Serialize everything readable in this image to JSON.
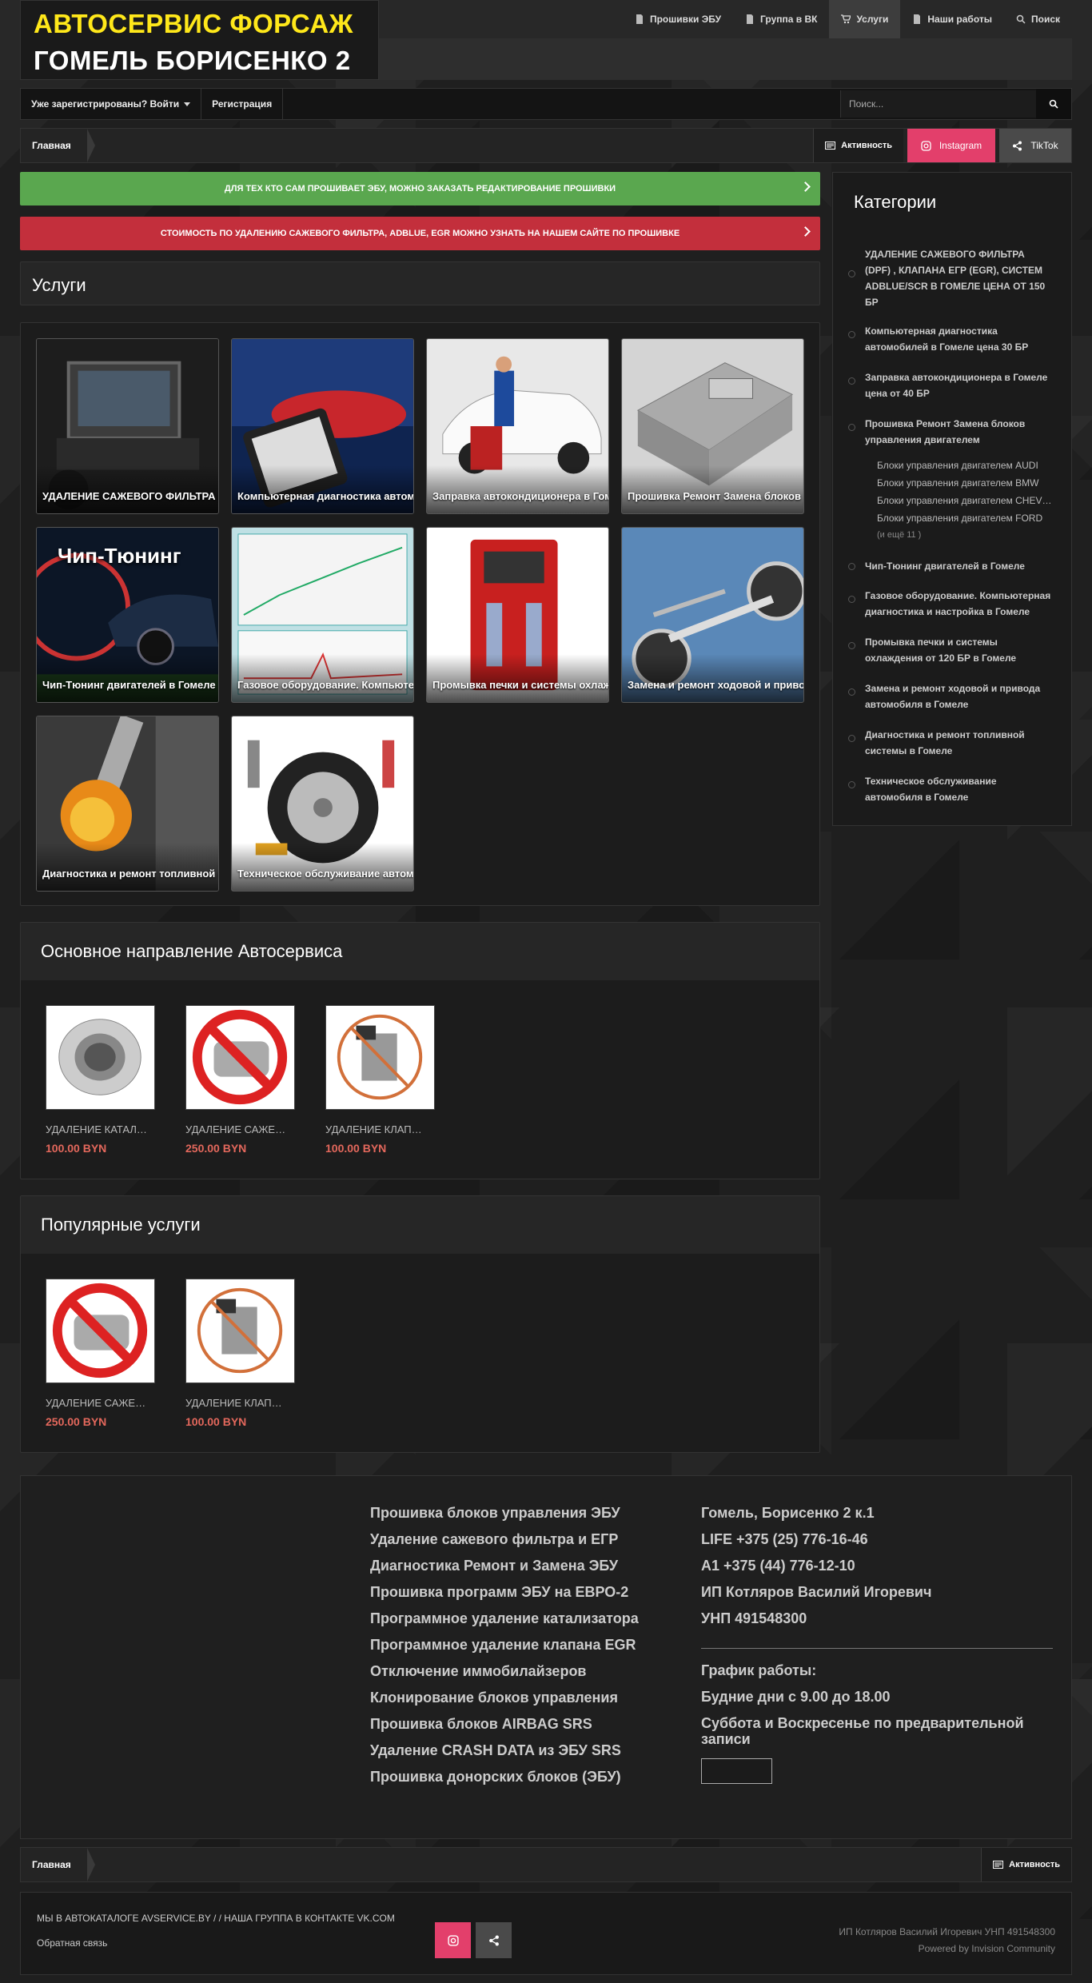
{
  "logo": {
    "line1": "АВТОСЕРВИС ФОРСАЖ",
    "line2": "ГОМЕЛЬ БОРИСЕНКО 2"
  },
  "topnav": [
    {
      "label": "Прошивки ЭБУ",
      "icon": "document-icon"
    },
    {
      "label": "Группа в ВК",
      "icon": "document-icon"
    },
    {
      "label": "Услуги",
      "icon": "cart-icon",
      "active": true
    },
    {
      "label": "Наши работы",
      "icon": "document-icon"
    },
    {
      "label": "Поиск",
      "icon": "search-icon"
    }
  ],
  "userbar": {
    "login": "Уже зарегистрированы? Войти",
    "register": "Регистрация",
    "search_placeholder": "Поиск..."
  },
  "breadcrumb": {
    "home": "Главная",
    "activity": "Активность",
    "instagram": "Instagram",
    "tiktok": "TikTok"
  },
  "banners": {
    "green": "ДЛЯ ТЕХ КТО САМ ПРОШИВАЕТ ЭБУ, МОЖНО ЗАКАЗАТЬ РЕДАКТИРОВАНИЕ ПРОШИВКИ",
    "red": "СТОИМОСТЬ ПО УДАЛЕНИЮ САЖЕВОГО ФИЛЬТРА, ADBLUE, EGR МОЖНО УЗНАТЬ НА НАШЕМ САЙТЕ ПО ПРОШИВКЕ"
  },
  "services": {
    "title": "Услуги",
    "tiles": [
      {
        "label": "УДАЛЕНИЕ САЖЕВОГО ФИЛЬТРА (DPF)",
        "art": "laptop"
      },
      {
        "label": "Компьютерная диагностика автомобилей",
        "art": "tablet-car"
      },
      {
        "label": "Заправка автокондиционера в Гомеле",
        "art": "white-car"
      },
      {
        "label": "Прошивка Ремонт Замена блоков",
        "art": "ecu"
      },
      {
        "label": "Чип-Тюнинг двигателей в Гомеле",
        "art": "chip",
        "overlay": "Чип-Тюнинг"
      },
      {
        "label": "Газовое оборудование. Компьютерная диагностика",
        "art": "graph"
      },
      {
        "label": "Промывка печки и системы охлаждения",
        "art": "machine"
      },
      {
        "label": "Замена и ремонт ходовой и привода",
        "art": "chassis"
      },
      {
        "label": "Диагностика и ремонт топливной системы",
        "art": "fuel"
      },
      {
        "label": "Техническое обслуживание автомобиля",
        "art": "parts"
      }
    ]
  },
  "main_direction": {
    "title": "Основное направление Автосервиса",
    "products": [
      {
        "name": "УДАЛЕНИЕ КАТАЛИЗАТОРА",
        "price": "100.00 BYN",
        "art": "catalyst"
      },
      {
        "name": "УДАЛЕНИЕ САЖЕВОГО ФИЛЬТРА",
        "price": "250.00 BYN",
        "art": "dpf-banned"
      },
      {
        "name": "УДАЛЕНИЕ КЛАПАНА EGR",
        "price": "100.00 BYN",
        "art": "egr-banned"
      }
    ]
  },
  "popular": {
    "title": "Популярные услуги",
    "products": [
      {
        "name": "УДАЛЕНИЕ САЖЕВОГО ФИЛЬТРА",
        "price": "250.00 BYN",
        "art": "dpf-banned"
      },
      {
        "name": "УДАЛЕНИЕ КЛАПАНА EGR",
        "price": "100.00 BYN",
        "art": "egr-banned"
      }
    ]
  },
  "categories": {
    "title": "Категории",
    "items": [
      {
        "label": "УДАЛЕНИЕ САЖЕВОГО ФИЛЬТРА (DPF) , КЛАПАНА ЕГР (EGR), СИСТЕМ ADBLUE/SCR В ГОМЕЛЕ ЦЕНА ОТ 150 БР"
      },
      {
        "label": "Компьютерная диагностика автомобилей в Гомеле цена 30 БР"
      },
      {
        "label": "Заправка автокондиционера в Гомеле цена от 40 БР"
      },
      {
        "label": "Прошивка Ремонт Замена блоков управления двигателем"
      },
      {
        "label": "Чип-Тюнинг двигателей в Гомеле"
      },
      {
        "label": "Газовое оборудование. Компьютерная диагностика и настройка в Гомеле"
      },
      {
        "label": "Промывка печки и системы охлаждения от 120 БР в Гомеле"
      },
      {
        "label": "Замена и ремонт ходовой и привода автомобиля в Гомеле"
      },
      {
        "label": "Диагностика и ремонт топливной системы в Гомеле"
      },
      {
        "label": "Техническое обслуживание автомобиля в Гомеле"
      }
    ],
    "subitems": [
      "Блоки управления двигателем AUDI",
      "Блоки управления двигателем BMW",
      "Блоки управления двигателем CHEVROLET",
      "Блоки управления двигателем FORD"
    ],
    "more": "(и ещё 11 )"
  },
  "footer": {
    "services": [
      "Прошивка блоков управления ЭБУ",
      "Удаление сажевого фильтра и ЕГР",
      "Диагностика Ремонт и Замена ЭБУ",
      "Прошивка программ ЭБУ на ЕВРО-2",
      "Программное удаление катализатора",
      "Программное удаление клапана EGR",
      "Отключение иммобилайзеров",
      "Клонирование блоков управления",
      "Прошивка блоков AIRBAG SRS",
      "Удаление CRASH DATA из ЭБУ SRS",
      "Прошивка донорских блоков (ЭБУ)"
    ],
    "contacts": [
      "Гомель, Борисенко 2 к.1",
      "LIFE +375 (25) 776-16-46",
      "А1 +375 (44) 776-12-10",
      "ИП Котляров Василий Игоревич",
      "УНП 491548300"
    ],
    "schedule_title": "График работы:",
    "schedule": [
      "Будние дни с 9.00 до 18.00",
      "Суббота и Воскресенье по предварительной записи"
    ]
  },
  "bottom": {
    "links": "МЫ В АВТОКАТАЛОГЕ AVSERVICE.BY / / НАША ГРУППА В КОНТАКТЕ VK.COM",
    "feedback": "Обратная связь",
    "owner": "ИП Котляров Василий Игоревич УНП 491548300",
    "powered": "Powered by Invision Community"
  },
  "colors": {
    "green": "#5aa74f",
    "red": "#c32f3c",
    "instagram": "#e33f6b",
    "price": "#e4685c",
    "logo_yellow": "#ffe81a"
  }
}
